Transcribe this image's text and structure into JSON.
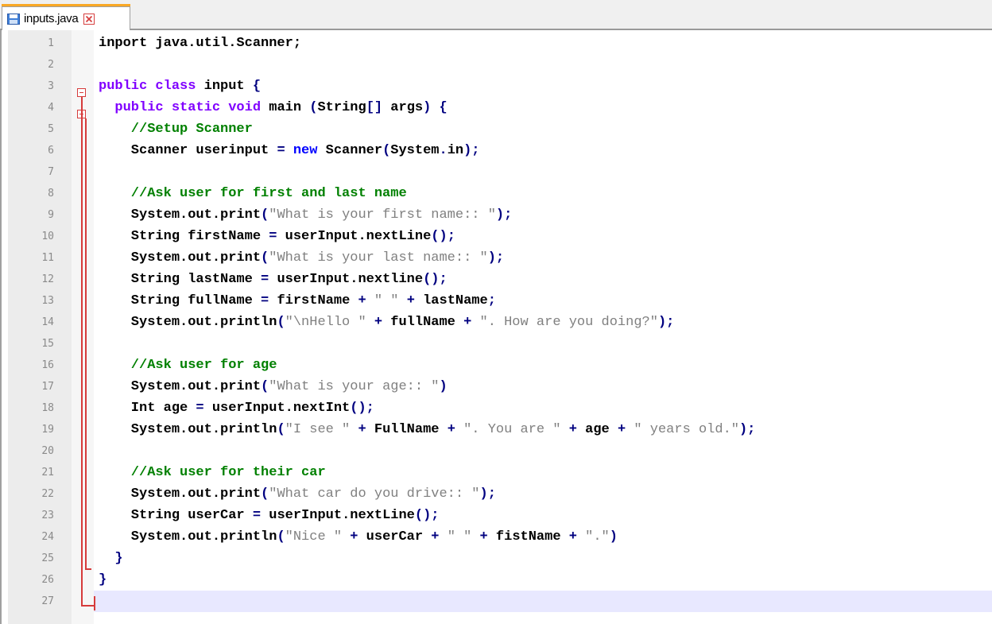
{
  "tab": {
    "label": "inputs.java",
    "save_icon": "floppy-disk-icon",
    "close_icon": "close-icon",
    "accent_color": "#f9a825"
  },
  "editor": {
    "lines": [
      {
        "num": "1",
        "segments": [
          {
            "t": "inport java.util.Scanner;",
            "c": "plain"
          }
        ]
      },
      {
        "num": "2",
        "segments": []
      },
      {
        "num": "3",
        "segments": [
          {
            "t": "public class",
            "c": "kw"
          },
          {
            "t": " input ",
            "c": "plain"
          },
          {
            "t": "{",
            "c": "op"
          }
        ]
      },
      {
        "num": "4",
        "segments": [
          {
            "t": "  public static void",
            "c": "kw"
          },
          {
            "t": " main ",
            "c": "plain"
          },
          {
            "t": "(",
            "c": "op"
          },
          {
            "t": "String",
            "c": "plain"
          },
          {
            "t": "[]",
            "c": "op"
          },
          {
            "t": " args",
            "c": "plain"
          },
          {
            "t": ") {",
            "c": "op"
          }
        ]
      },
      {
        "num": "5",
        "segments": [
          {
            "t": "    //Setup Scanner",
            "c": "cmt"
          }
        ]
      },
      {
        "num": "6",
        "segments": [
          {
            "t": "    Scanner userinput ",
            "c": "plain"
          },
          {
            "t": "=",
            "c": "op"
          },
          {
            "t": " new",
            "c": "kwb"
          },
          {
            "t": " Scanner",
            "c": "plain"
          },
          {
            "t": "(",
            "c": "op"
          },
          {
            "t": "System",
            "c": "plain"
          },
          {
            "t": ".",
            "c": "op"
          },
          {
            "t": "in",
            "c": "plain"
          },
          {
            "t": ");",
            "c": "op"
          }
        ]
      },
      {
        "num": "7",
        "segments": []
      },
      {
        "num": "8",
        "segments": [
          {
            "t": "    //Ask user for first and last name",
            "c": "cmt"
          }
        ]
      },
      {
        "num": "9",
        "segments": [
          {
            "t": "    System.out.print",
            "c": "plain"
          },
          {
            "t": "(",
            "c": "op"
          },
          {
            "t": "\"What is your first name:: \"",
            "c": "str"
          },
          {
            "t": ");",
            "c": "op"
          }
        ]
      },
      {
        "num": "10",
        "segments": [
          {
            "t": "    String firstName ",
            "c": "plain"
          },
          {
            "t": "=",
            "c": "op"
          },
          {
            "t": " userInput.nextLine",
            "c": "plain"
          },
          {
            "t": "();",
            "c": "op"
          }
        ]
      },
      {
        "num": "11",
        "segments": [
          {
            "t": "    System.out.print",
            "c": "plain"
          },
          {
            "t": "(",
            "c": "op"
          },
          {
            "t": "\"What is your last name:: \"",
            "c": "str"
          },
          {
            "t": ");",
            "c": "op"
          }
        ]
      },
      {
        "num": "12",
        "segments": [
          {
            "t": "    String lastName ",
            "c": "plain"
          },
          {
            "t": "=",
            "c": "op"
          },
          {
            "t": " userInput.nextline",
            "c": "plain"
          },
          {
            "t": "();",
            "c": "op"
          }
        ]
      },
      {
        "num": "13",
        "segments": [
          {
            "t": "    String fullName ",
            "c": "plain"
          },
          {
            "t": "=",
            "c": "op"
          },
          {
            "t": " firstName ",
            "c": "plain"
          },
          {
            "t": "+",
            "c": "op"
          },
          {
            "t": " \" \" ",
            "c": "str"
          },
          {
            "t": "+",
            "c": "op"
          },
          {
            "t": " lastName",
            "c": "plain"
          },
          {
            "t": ";",
            "c": "op"
          }
        ]
      },
      {
        "num": "14",
        "segments": [
          {
            "t": "    System.out.println",
            "c": "plain"
          },
          {
            "t": "(",
            "c": "op"
          },
          {
            "t": "\"\\nHello \" ",
            "c": "str"
          },
          {
            "t": "+",
            "c": "op"
          },
          {
            "t": " fullName ",
            "c": "plain"
          },
          {
            "t": "+",
            "c": "op"
          },
          {
            "t": " \". How are you doing?\"",
            "c": "str"
          },
          {
            "t": ");",
            "c": "op"
          }
        ]
      },
      {
        "num": "15",
        "segments": []
      },
      {
        "num": "16",
        "segments": [
          {
            "t": "    //Ask user for age",
            "c": "cmt"
          }
        ]
      },
      {
        "num": "17",
        "segments": [
          {
            "t": "    System.out.print",
            "c": "plain"
          },
          {
            "t": "(",
            "c": "op"
          },
          {
            "t": "\"What is your age:: \"",
            "c": "str"
          },
          {
            "t": ")",
            "c": "op"
          }
        ]
      },
      {
        "num": "18",
        "segments": [
          {
            "t": "    Int age ",
            "c": "plain"
          },
          {
            "t": "=",
            "c": "op"
          },
          {
            "t": " userInput.nextInt",
            "c": "plain"
          },
          {
            "t": "();",
            "c": "op"
          }
        ]
      },
      {
        "num": "19",
        "segments": [
          {
            "t": "    System.out.println",
            "c": "plain"
          },
          {
            "t": "(",
            "c": "op"
          },
          {
            "t": "\"I see \" ",
            "c": "str"
          },
          {
            "t": "+",
            "c": "op"
          },
          {
            "t": " FullName ",
            "c": "plain"
          },
          {
            "t": "+",
            "c": "op"
          },
          {
            "t": " \". You are \" ",
            "c": "str"
          },
          {
            "t": "+",
            "c": "op"
          },
          {
            "t": " age ",
            "c": "plain"
          },
          {
            "t": "+",
            "c": "op"
          },
          {
            "t": " \" years old.\"",
            "c": "str"
          },
          {
            "t": ");",
            "c": "op"
          }
        ]
      },
      {
        "num": "20",
        "segments": []
      },
      {
        "num": "21",
        "segments": [
          {
            "t": "    //Ask user for their car",
            "c": "cmt"
          }
        ]
      },
      {
        "num": "22",
        "segments": [
          {
            "t": "    System.out.print",
            "c": "plain"
          },
          {
            "t": "(",
            "c": "op"
          },
          {
            "t": "\"What car do you drive:: \"",
            "c": "str"
          },
          {
            "t": ");",
            "c": "op"
          }
        ]
      },
      {
        "num": "23",
        "segments": [
          {
            "t": "    String userCar ",
            "c": "plain"
          },
          {
            "t": "=",
            "c": "op"
          },
          {
            "t": " userInput.nextLine",
            "c": "plain"
          },
          {
            "t": "();",
            "c": "op"
          }
        ]
      },
      {
        "num": "24",
        "segments": [
          {
            "t": "    System.out.println",
            "c": "plain"
          },
          {
            "t": "(",
            "c": "op"
          },
          {
            "t": "\"Nice \" ",
            "c": "str"
          },
          {
            "t": "+",
            "c": "op"
          },
          {
            "t": " userCar ",
            "c": "plain"
          },
          {
            "t": "+",
            "c": "op"
          },
          {
            "t": " \" \" ",
            "c": "str"
          },
          {
            "t": "+",
            "c": "op"
          },
          {
            "t": " fistName ",
            "c": "plain"
          },
          {
            "t": "+",
            "c": "op"
          },
          {
            "t": " \".\"",
            "c": "str"
          },
          {
            "t": ")",
            "c": "op"
          }
        ]
      },
      {
        "num": "25",
        "segments": [
          {
            "t": "  }",
            "c": "op"
          }
        ]
      },
      {
        "num": "26",
        "segments": [
          {
            "t": "}",
            "c": "op"
          }
        ]
      },
      {
        "num": "27",
        "segments": []
      }
    ],
    "current_line": "27",
    "fold_color": "#d63b3b"
  }
}
